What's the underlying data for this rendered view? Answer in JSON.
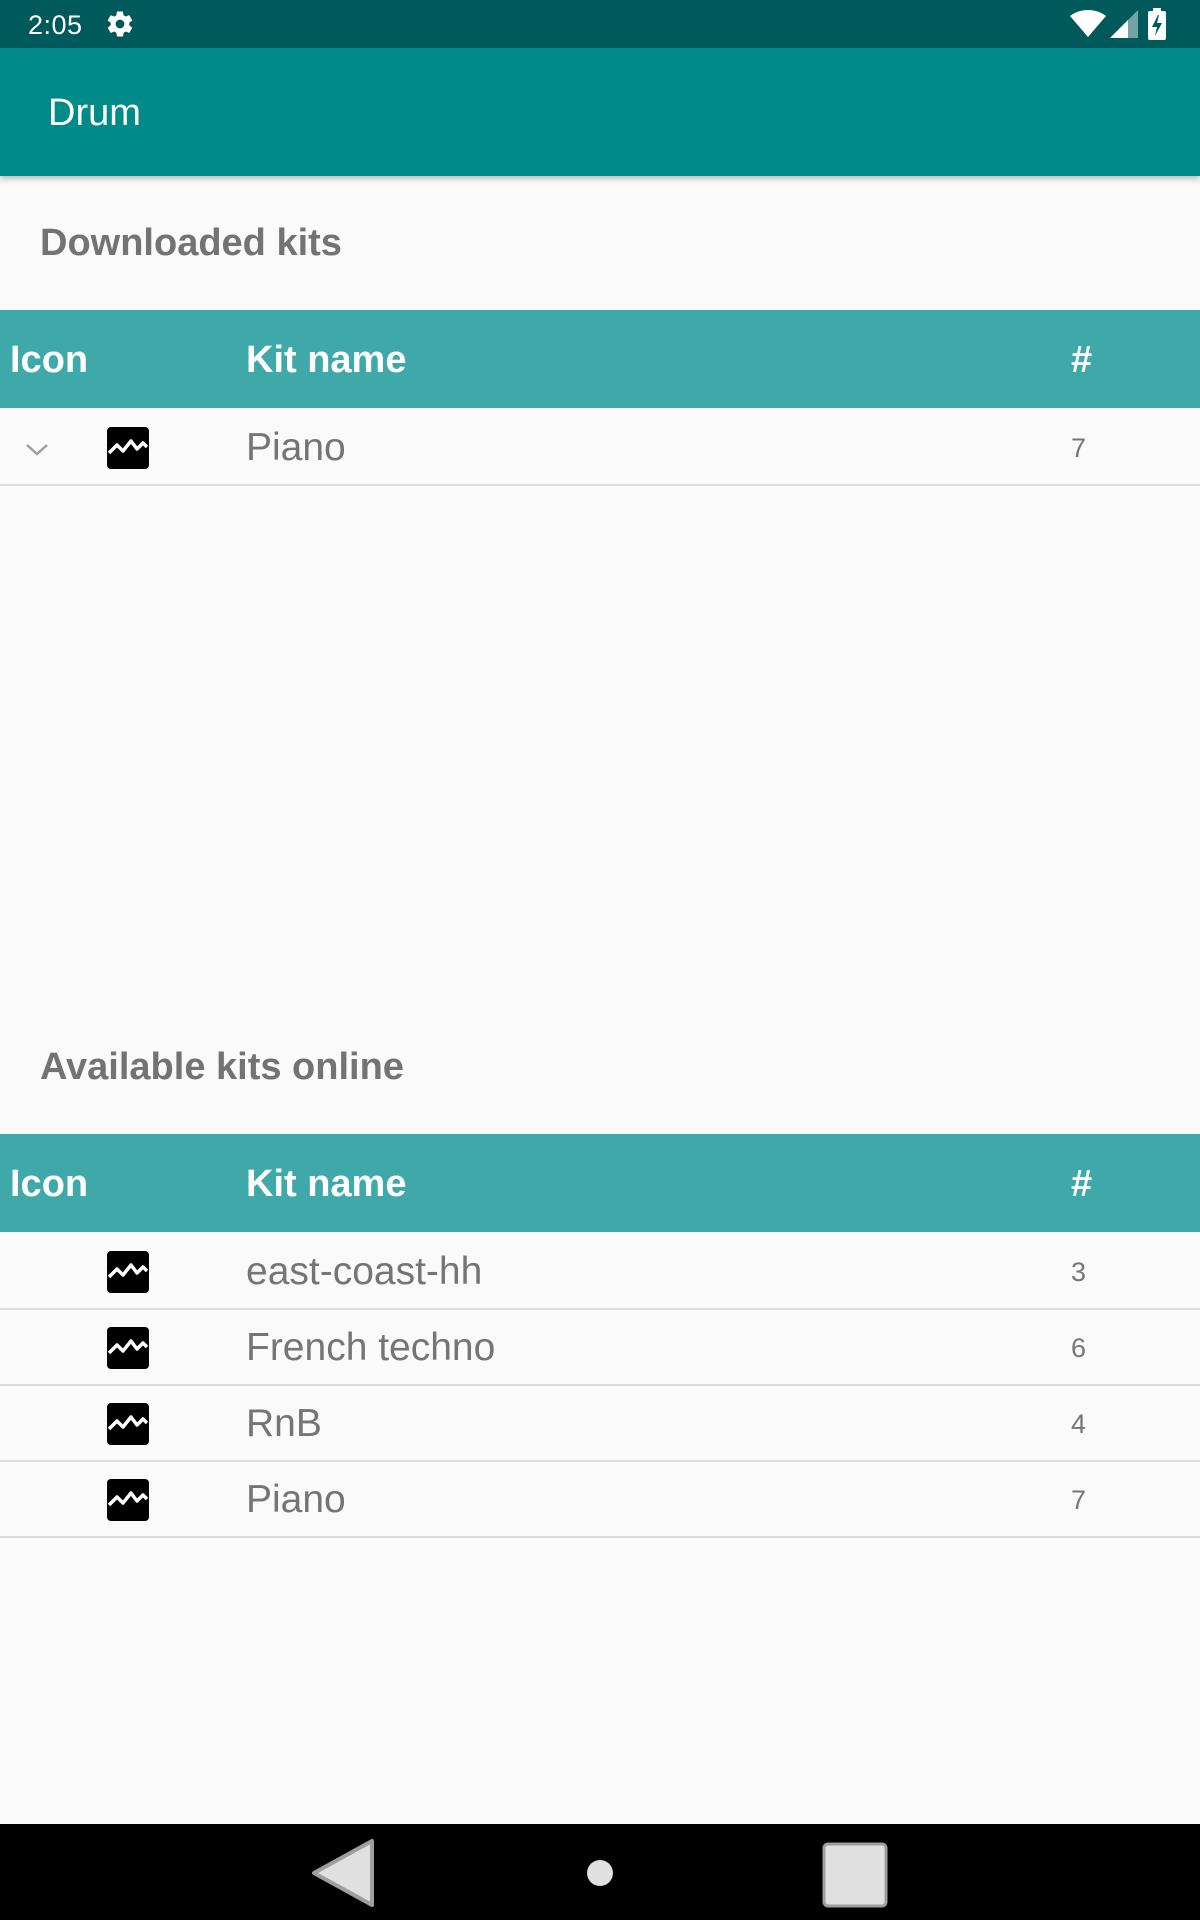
{
  "status_bar": {
    "time": "2:05",
    "icons": [
      "gear-icon",
      "wifi-icon",
      "signal-icon",
      "battery-charging-icon"
    ],
    "color": "#00595b"
  },
  "app_bar": {
    "title": "Drum",
    "color": "#008b88"
  },
  "downloaded": {
    "title": "Downloaded kits",
    "header": {
      "icon": "Icon",
      "name": "Kit name",
      "count": "#"
    },
    "rows": [
      {
        "name": "Piano",
        "count": "7",
        "icon": "waveform-icon",
        "expand_icon": "chevron-down-icon"
      }
    ]
  },
  "online": {
    "title": "Available kits online",
    "header": {
      "icon": "Icon",
      "name": "Kit name",
      "count": "#"
    },
    "rows": [
      {
        "name": "east-coast-hh",
        "count": "3",
        "icon": "waveform-icon"
      },
      {
        "name": "French techno",
        "count": "6",
        "icon": "waveform-icon"
      },
      {
        "name": "RnB",
        "count": "4",
        "icon": "waveform-icon"
      },
      {
        "name": "Piano",
        "count": "7",
        "icon": "waveform-icon"
      }
    ]
  },
  "header_color": "#3fa9a9",
  "nav_bar": {
    "icons": [
      "back-icon",
      "home-icon",
      "recents-icon"
    ]
  }
}
